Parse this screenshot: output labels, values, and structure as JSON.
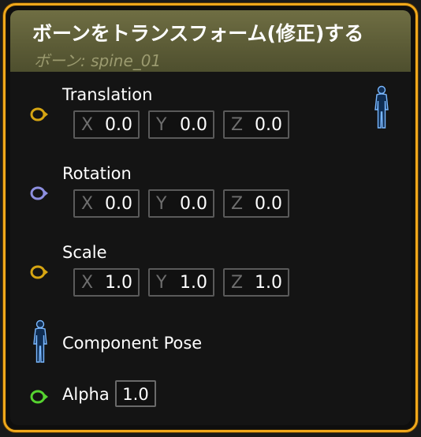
{
  "node": {
    "title": "ボーンをトランスフォーム(修正)する",
    "subtitle": "ボーン: spine_01"
  },
  "pins": {
    "translation": {
      "label": "Translation",
      "color": "#d6a512",
      "x": {
        "axis": "X",
        "value": "0.0"
      },
      "y": {
        "axis": "Y",
        "value": "0.0"
      },
      "z": {
        "axis": "Z",
        "value": "0.0"
      }
    },
    "rotation": {
      "label": "Rotation",
      "color": "#8d8fe0",
      "x": {
        "axis": "X",
        "value": "0.0"
      },
      "y": {
        "axis": "Y",
        "value": "0.0"
      },
      "z": {
        "axis": "Z",
        "value": "0.0"
      }
    },
    "scale": {
      "label": "Scale",
      "color": "#d6a512",
      "x": {
        "axis": "X",
        "value": "1.0"
      },
      "y": {
        "axis": "Y",
        "value": "1.0"
      },
      "z": {
        "axis": "Z",
        "value": "1.0"
      }
    },
    "component_pose": {
      "label": "Component Pose",
      "icon": "pose-figure-icon",
      "color": "#7ab8ff"
    },
    "alpha": {
      "label": "Alpha",
      "value": "1.0",
      "color": "#56d330"
    }
  },
  "output": {
    "icon": "pose-figure-icon",
    "color": "#7ab8ff"
  },
  "colors": {
    "border_accent": "#f0a81b",
    "header_bg": "#5b5b36"
  }
}
